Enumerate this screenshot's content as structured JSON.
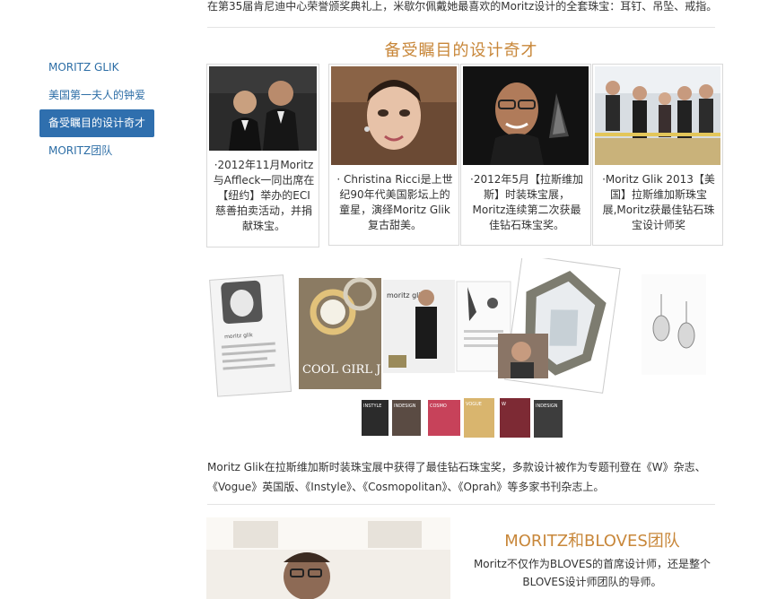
{
  "top_text": "在第35届肯尼迪中心荣誉颁奖典礼上，米歇尔佩戴她最喜欢的Moritz设计的全套珠宝：耳钉、吊坠、戒指。",
  "sidebar": {
    "items": [
      {
        "label": "MORITZ GLIK",
        "active": false
      },
      {
        "label": "美国第一夫人的钟爱",
        "active": false
      },
      {
        "label": "备受瞩目的设计奇才",
        "active": true
      },
      {
        "label": "MORITZ团队",
        "active": false
      }
    ]
  },
  "section_title": "备受瞩目的设计奇才",
  "cards": [
    {
      "caption": "·2012年11月Moritz与Affleck一同出席在【纽约】举办的ECI慈善拍卖活动，并捐献珠宝。"
    },
    {
      "caption": "· Christina Ricci是上世纪90年代美国影坛上的童星，演绎Moritz Glik复古甜美。"
    },
    {
      "caption": "·2012年5月【拉斯维加斯】时装珠宝展，Moritz连续第二次获最佳钻石珠宝奖。"
    },
    {
      "caption": "·Moritz Glik 2013【美国】拉斯维加斯珠宝展,Moritz获最佳钻石珠宝设计师奖"
    }
  ],
  "collage": {
    "magazine_label_1": "moritz glik",
    "magazine_label_2": "moritz glik",
    "headline": "COOL GIRL JEWELS",
    "covers": [
      "INSTYLE",
      "INDESIGN",
      "COSMO",
      "VOGUE",
      "W",
      "INDESIGN"
    ]
  },
  "paragraph": "Moritz Glik在拉斯维加斯时装珠宝展中获得了最佳钻石珠宝奖，多款设计被作为专题刊登在《W》杂志、《Vogue》英国版、《Instyle》、《Cosmopolitan》、《Oprah》等多家书刊杂志上。",
  "team": {
    "title": "MORITZ和BLOVES团队",
    "text": "Moritz不仅作为BLOVES的首席设计师，还是整个BLOVES设计师团队的导师。"
  },
  "colors": {
    "accent_title": "#c8873a",
    "nav_link": "#2d6ea6",
    "nav_active_bg": "#2f6fae"
  }
}
